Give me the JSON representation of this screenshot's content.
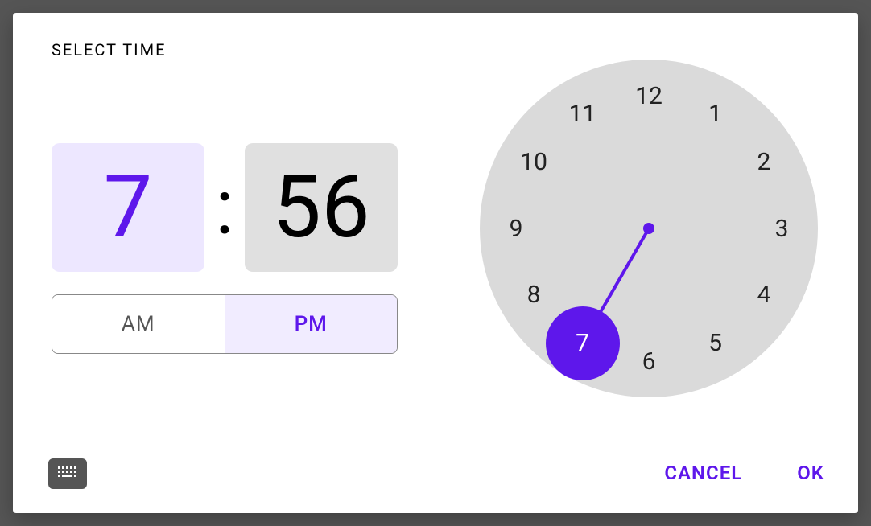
{
  "title": "SELECT TIME",
  "time": {
    "hour": "7",
    "minute": "56",
    "selected_field": "hour",
    "period": "PM"
  },
  "period_options": {
    "am": "AM",
    "pm": "PM"
  },
  "clock": {
    "hours": [
      "12",
      "1",
      "2",
      "3",
      "4",
      "5",
      "6",
      "7",
      "8",
      "9",
      "10",
      "11"
    ],
    "selected_hour": 7
  },
  "actions": {
    "cancel": "CANCEL",
    "ok": "OK"
  },
  "colors": {
    "accent": "#5E17EB",
    "accent_light": "#EDE7FF",
    "neutral_box": "#E0E0E0",
    "clock_face": "#DADADA"
  }
}
